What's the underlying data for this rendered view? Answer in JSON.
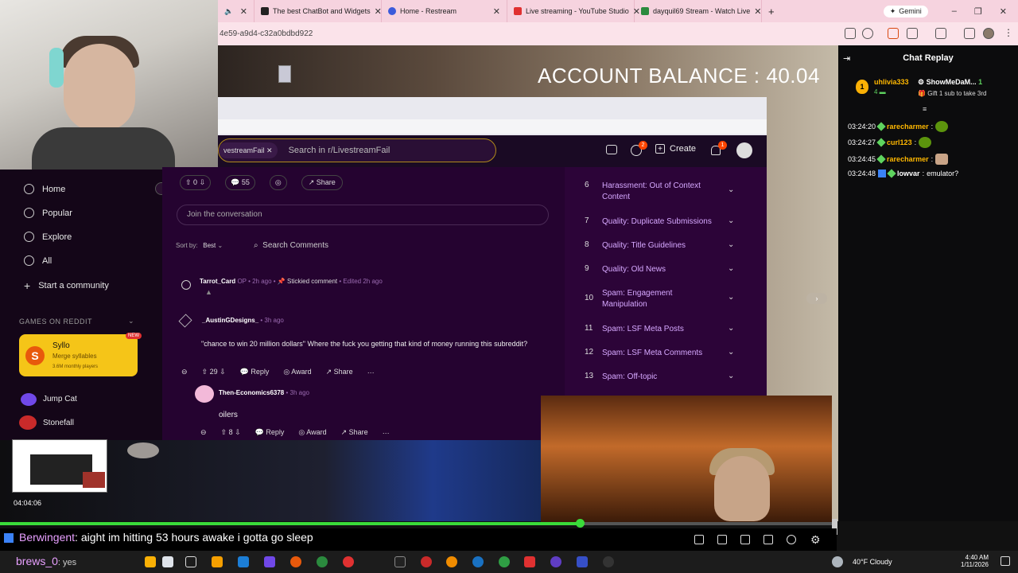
{
  "browser": {
    "tabs": [
      {
        "label": "",
        "color": "#7a7a7a"
      },
      {
        "label": "The best ChatBot and Widgets",
        "color": "#222222"
      },
      {
        "label": "Home - Restream",
        "color": "#3b5bdb"
      },
      {
        "label": "Live streaming - YouTube Studio",
        "color": "#e03131"
      },
      {
        "label": "dayquil69 Stream - Watch Live",
        "color": "#2b8a3e"
      }
    ],
    "new_tab": "+",
    "gemini": "Gemini",
    "url": "4e59-a9d4-c32a0bdbd922"
  },
  "stream": {
    "account_balance": "ACCOUNT BALANCE : 40.04"
  },
  "reddit": {
    "subreddit_chip": "vestreamFail",
    "search_placeholder": "Search in r/LivestreamFail",
    "create": "Create",
    "notifications": "1",
    "chat_badge": "2",
    "sidebar": {
      "home": "Home",
      "popular": "Popular",
      "explore": "Explore",
      "all": "All",
      "start_community": "Start a community",
      "games_header": "GAMES ON REDDIT",
      "game_name": "Syllo",
      "game_sub": "Merge syllables",
      "game_players": "3.6M monthly players",
      "game_new": "NEW",
      "jump_cat": "Jump Cat",
      "stonefall": "Stonefall"
    },
    "post_actions": {
      "votes": "0",
      "comments": "55",
      "share": "Share"
    },
    "join_placeholder": "Join the conversation",
    "sort_label": "Sort by:",
    "sort_value": "Best",
    "search_comments": "Search Comments",
    "comments": [
      {
        "user": "Tarrot_Card",
        "meta": "OP • 2h ago • ",
        "stickied": "Stickied comment",
        "edited": "• Edited 2h ago",
        "text": ""
      },
      {
        "user": "_AustinGDesigns_",
        "meta": "• 3h ago",
        "text": "\"chance to win 20 million dollars\" Where the fuck you getting that kind of money running this subreddit?",
        "votes": "29",
        "reply": "Reply",
        "award": "Award",
        "share": "Share"
      },
      {
        "user": "Then-Economics6378",
        "meta": "• 3h ago",
        "text": "oilers",
        "votes": "8",
        "reply": "Reply",
        "award": "Award",
        "share": "Share"
      }
    ],
    "rules": [
      {
        "n": "6",
        "t": "Harassment: Out of Context Content"
      },
      {
        "n": "7",
        "t": "Quality: Duplicate Submissions"
      },
      {
        "n": "8",
        "t": "Quality: Title Guidelines"
      },
      {
        "n": "9",
        "t": "Quality: Old News"
      },
      {
        "n": "10",
        "t": "Spam: Engagement Manipulation"
      },
      {
        "n": "11",
        "t": "Spam: LSF Meta Posts"
      },
      {
        "n": "12",
        "t": "Spam: LSF Meta Comments"
      },
      {
        "n": "13",
        "t": "Spam: Off-topic"
      }
    ]
  },
  "chat": {
    "title": "Chat Replay",
    "pinned_rank": "1",
    "pinned_user": "uhlivia333",
    "pinned_count": "4",
    "pinned_user2": "ShowMeDaM...",
    "pinned_count2": "1",
    "pinned_gift": "Gift 1 sub to take 3rd",
    "messages": [
      {
        "time": "03:24:20",
        "user": "rarecharmer",
        "text": ""
      },
      {
        "time": "03:24:27",
        "user": "curl123",
        "text": ""
      },
      {
        "time": "03:24:45",
        "user": "rarecharmer",
        "text": ""
      },
      {
        "time": "03:24:48",
        "user": "lowvar",
        "text": "emulator?"
      }
    ]
  },
  "player": {
    "timestamp": "04:04:06",
    "progress": 0.693,
    "subtitle_name": "Berwingent",
    "subtitle_text": ": aight im hitting 53 hours awake i gotta go sleep",
    "subtitle2_name": "brews_0",
    "subtitle2_text": ": yes"
  },
  "taskbar": {
    "weather": "40°F  Cloudy",
    "time": "4:40 AM",
    "date": "1/11/2026"
  }
}
